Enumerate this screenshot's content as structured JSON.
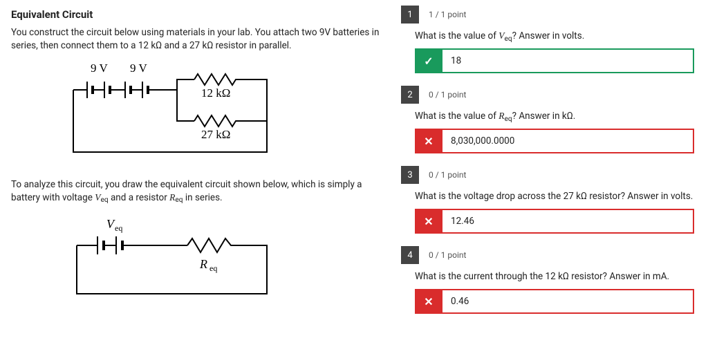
{
  "left": {
    "title": "Equivalent Circuit",
    "desc1": "You construct the circuit below using materials in your lab. You attach two 9V batteries in series, then connect them to a 12 kΩ and a 27 kΩ resistor in parallel.",
    "desc2_a": "To analyze this circuit, you draw the equivalent circuit shown below, which is simply a battery with voltage ",
    "desc2_b": " and a resistor ",
    "desc2_c": " in series.",
    "Veq": "Veq",
    "Req": "Req",
    "d1": {
      "v1": "9 V",
      "v2": "9 V",
      "r1": "12 kΩ",
      "r2": "27 kΩ"
    },
    "d2": {
      "v": "V",
      "vsub": "eq",
      "r": "R",
      "rsub": "eq"
    }
  },
  "questions": [
    {
      "num": "1",
      "points": "1 / 1 point",
      "prompt_a": "What is the value of ",
      "prompt_var": "V",
      "prompt_sub": "eq",
      "prompt_b": "? Answer in volts.",
      "status": "correct",
      "answer": "18"
    },
    {
      "num": "2",
      "points": "0 / 1 point",
      "prompt_a": "What is the value of ",
      "prompt_var": "R",
      "prompt_sub": "eq",
      "prompt_b": "? Answer in kΩ.",
      "status": "incorrect",
      "answer": "8,030,000.0000"
    },
    {
      "num": "3",
      "points": "0 / 1 point",
      "prompt_plain": "What is the voltage drop across the 27 kΩ resistor? Answer in volts.",
      "status": "incorrect",
      "answer": "12.46"
    },
    {
      "num": "4",
      "points": "0 / 1 point",
      "prompt_plain": "What is the current through the 12 kΩ resistor? Answer in mA.",
      "status": "incorrect",
      "answer": "0.46"
    }
  ]
}
